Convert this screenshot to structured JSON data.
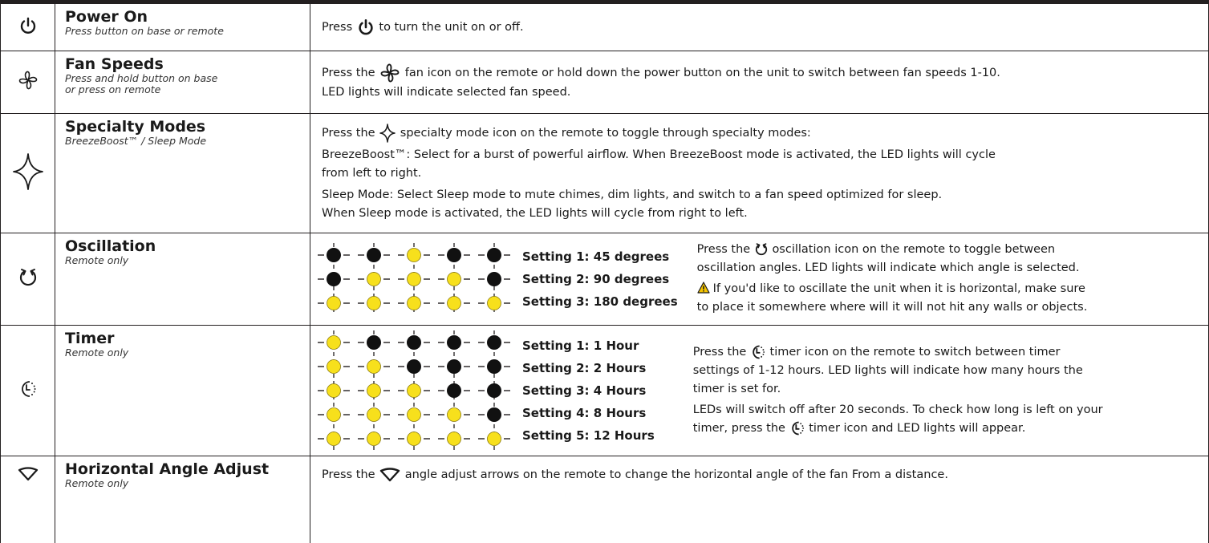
{
  "colors": {
    "led_on": "#f7e01c",
    "led_off": "#111111",
    "line": "#231f20",
    "warning": "#f5c400"
  },
  "rows": {
    "power": {
      "icon": "power-icon",
      "title": "Power On",
      "subtitle": "Press button on base or remote",
      "text_before": "Press",
      "text_after": "to turn the unit on or off."
    },
    "fan": {
      "icon": "fan-icon",
      "title": "Fan Speeds",
      "subtitle_1": "Press and hold button on base",
      "subtitle_2": "or press on remote",
      "line1_before": "Press the",
      "line1_after": "fan icon on the remote or hold down the power button on the unit to switch between fan speeds 1-10.",
      "line2": "LED lights will indicate selected fan speed."
    },
    "specialty": {
      "icon": "sparkle-icon",
      "title": "Specialty Modes",
      "subtitle": "BreezeBoost™ / Sleep Mode",
      "line1_before": "Press the",
      "line1_after": "specialty mode icon on the remote to toggle through specialty modes:",
      "boost_1": "BreezeBoost™: Select for a burst of powerful airflow. When BreezeBoost mode is activated, the LED lights will cycle",
      "boost_2": "from left to right.",
      "sleep_1": "Sleep Mode: Select Sleep mode to mute chimes, dim lights, and switch to a fan speed optimized for sleep.",
      "sleep_2": "When Sleep mode is activated, the LED lights will cycle from right to left."
    },
    "oscillation": {
      "icon": "oscillation-icon",
      "title": "Oscillation",
      "subtitle": "Remote only",
      "settings": [
        {
          "label": "Setting 1:",
          "value": "45 degrees",
          "leds": [
            0,
            0,
            1,
            0,
            0
          ]
        },
        {
          "label": "Setting 2:",
          "value": "90 degrees",
          "leds": [
            0,
            1,
            1,
            1,
            0
          ]
        },
        {
          "label": "Setting 3:",
          "value": "180 degrees",
          "leds": [
            1,
            1,
            1,
            1,
            1
          ]
        }
      ],
      "text1_before": "Press the",
      "text1_after": "oscillation icon on the remote to toggle between",
      "text2": "oscillation angles. LED lights will indicate which angle is selected.",
      "warn_1": "If you'd like to oscillate the unit when it is horizontal, make sure",
      "warn_2": "to place it somewhere where will it will not hit any walls or objects."
    },
    "timer": {
      "icon": "timer-icon",
      "title": "Timer",
      "subtitle": "Remote only",
      "settings": [
        {
          "label": "Setting 1:",
          "value": "1 Hour",
          "leds": [
            1,
            0,
            0,
            0,
            0
          ]
        },
        {
          "label": "Setting 2:",
          "value": "2 Hours",
          "leds": [
            1,
            1,
            0,
            0,
            0
          ]
        },
        {
          "label": "Setting 3:",
          "value": "4 Hours",
          "leds": [
            1,
            1,
            1,
            0,
            0
          ]
        },
        {
          "label": "Setting 4:",
          "value": "8 Hours",
          "leds": [
            1,
            1,
            1,
            1,
            0
          ]
        },
        {
          "label": "Setting 5:",
          "value": "12 Hours",
          "leds": [
            1,
            1,
            1,
            1,
            1
          ]
        }
      ],
      "text1_before": "Press the",
      "text1_after": "timer icon on the remote to switch between timer",
      "text2": "settings of 1-12 hours. LED lights will indicate how many hours the",
      "text3": "timer is set for.",
      "text4": "LEDs will switch off after 20 seconds. To check how long is left on your",
      "text5_before": "timer, press the",
      "text5_after": "timer icon and LED lights will appear."
    },
    "angle": {
      "icon": "angle-adjust-icon",
      "title": "Horizontal Angle Adjust",
      "subtitle": "Remote only",
      "text_before": "Press the",
      "text_after": "angle adjust arrows on the remote to change the horizontal angle of the fan From a distance."
    }
  }
}
